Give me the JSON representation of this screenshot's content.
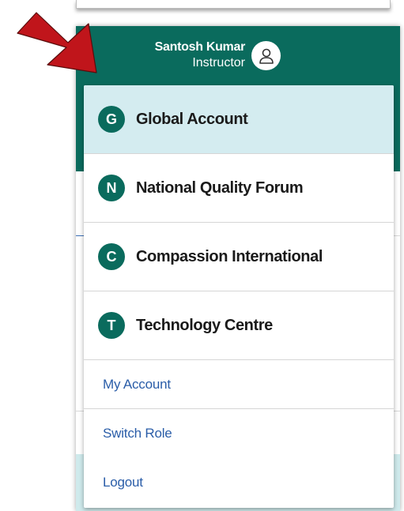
{
  "header": {
    "user_name": "Santosh Kumar",
    "user_role": "Instructor",
    "color": "#0a6b5d"
  },
  "dropdown": {
    "organizations": [
      {
        "initial": "G",
        "name": "Global Account",
        "selected": true
      },
      {
        "initial": "N",
        "name": "National Quality Forum",
        "selected": false
      },
      {
        "initial": "C",
        "name": "Compassion International",
        "selected": false
      },
      {
        "initial": "T",
        "name": "Technology Centre",
        "selected": false
      }
    ],
    "links": {
      "my_account": "My Account",
      "switch_role": "Switch Role",
      "logout": "Logout"
    },
    "link_color": "#2a5da8",
    "selected_bg": "#d4ecf0"
  },
  "annotation": {
    "arrow_color": "#c0151b",
    "icon": "red-pointer-arrow-icon"
  }
}
